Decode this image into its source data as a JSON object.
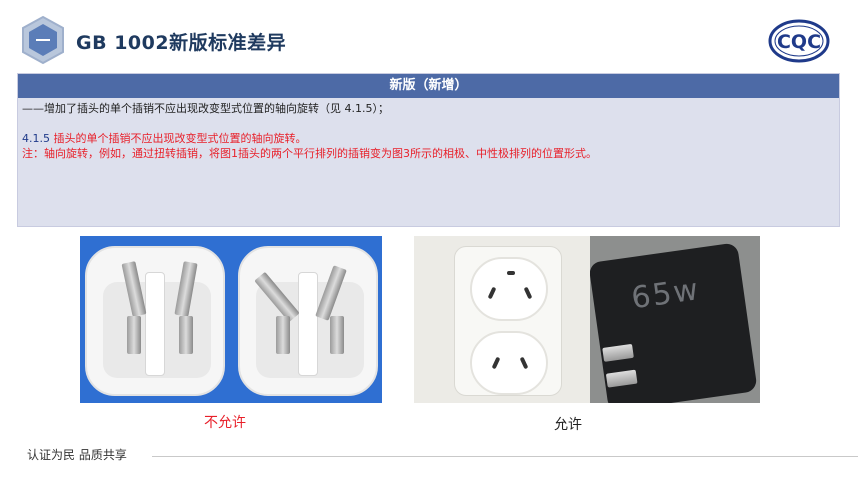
{
  "header": {
    "title": "GB 1002新版标准差异",
    "logo_icon": "shield-badge-icon",
    "brand_logo": "CQC",
    "brand_color": "#1f3a8a"
  },
  "panel": {
    "heading": "新版（新增）",
    "heading_bg": "#4d6aa6",
    "line1": "——增加了插头的单个插销不应出现改变型式位置的轴向旋转（见 4.1.5）；",
    "clause_no": "4.1.5",
    "clause_text": " 插头的单个插销不应出现改变型式位置的轴向旋转。",
    "note": "注：轴向旋转，例如，通过扭转插销，将图1插头的两个平行排列的插销变为图3所示的相极、中性极排列的位置形式。",
    "note_color": "#e8202a"
  },
  "photos": {
    "charger_label": "65w"
  },
  "captions": {
    "not_allowed": "不允许",
    "allowed": "允许"
  },
  "footer": {
    "slogan": "认证为民  品质共享"
  }
}
